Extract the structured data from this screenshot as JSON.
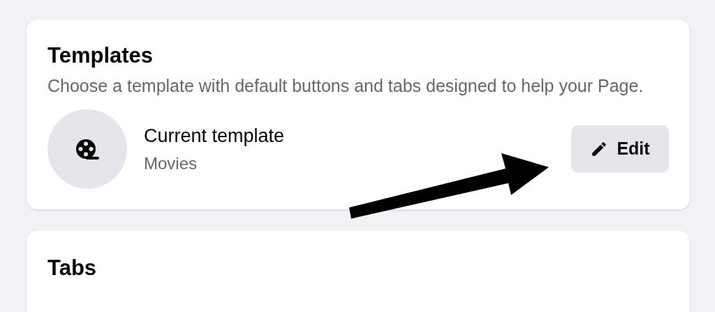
{
  "templates": {
    "title": "Templates",
    "description": "Choose a template with default buttons and tabs designed to help your Page.",
    "current": {
      "label": "Current template",
      "value": "Movies"
    },
    "edit_button": "Edit"
  },
  "tabs_section": {
    "title": "Tabs"
  }
}
